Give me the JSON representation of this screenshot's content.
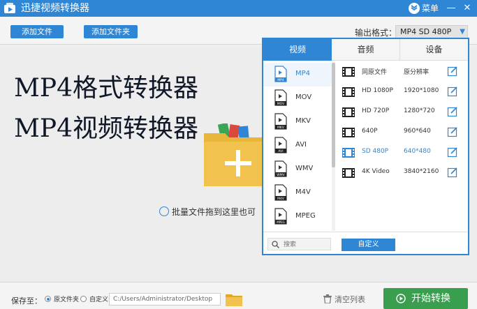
{
  "window": {
    "title": "迅捷视频转换器",
    "menu_label": "菜单",
    "minimize": "—",
    "close": "✕"
  },
  "toolbar": {
    "add_file": "添加文件",
    "add_folder": "添加文件夹",
    "output_format_label": "输出格式：",
    "output_format_value": "MP4  SD 480P"
  },
  "main": {
    "promo_line1": "MP4格式转换器",
    "promo_line2": "MP4视频转换器",
    "drop_hint": "批量文件拖到这里也可"
  },
  "format_popup": {
    "tabs": [
      "视频",
      "音频",
      "设备"
    ],
    "formats": [
      {
        "name": "MP4",
        "badge": "MP4",
        "active": true
      },
      {
        "name": "MOV",
        "badge": "MOV"
      },
      {
        "name": "MKV",
        "badge": "MKV"
      },
      {
        "name": "AVI",
        "badge": "AVI"
      },
      {
        "name": "WMV",
        "badge": "WMV"
      },
      {
        "name": "M4V",
        "badge": "M4V"
      },
      {
        "name": "MPEG",
        "badge": "MPEG"
      }
    ],
    "presets": [
      {
        "name": "同原文件",
        "resolution": "原分辨率"
      },
      {
        "name": "HD 1080P",
        "resolution": "1920*1080"
      },
      {
        "name": "HD 720P",
        "resolution": "1280*720"
      },
      {
        "name": "640P",
        "resolution": "960*640"
      },
      {
        "name": "SD 480P",
        "resolution": "640*480",
        "active": true
      },
      {
        "name": "4K Video",
        "resolution": "3840*2160"
      }
    ],
    "search_placeholder": "搜索",
    "custom_button": "自定义"
  },
  "bottombar": {
    "save_to_label": "保存至：",
    "option_source_folder": "原文件夹",
    "option_custom": "自定义",
    "path_value": "C:/Users/Administrator/Desktop",
    "clear_list": "清空列表",
    "start_convert": "开始转换"
  },
  "colors": {
    "accent": "#2f86d4",
    "start_green": "#3a9e4f"
  }
}
